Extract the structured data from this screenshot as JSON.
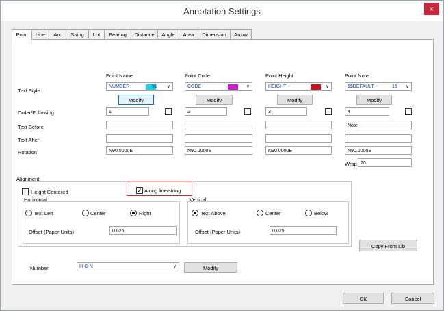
{
  "window": {
    "title": "Annotation Settings",
    "close_label": "×"
  },
  "tabs": [
    "Point",
    "Line",
    "Arc",
    "String",
    "Lot",
    "Bearing",
    "Distance",
    "Angle",
    "Area",
    "Dimension",
    "Arrow"
  ],
  "columns": {
    "point_name": {
      "header": "Point Name",
      "style": "NUMBER",
      "num": "51",
      "swatch": "#19d3e6",
      "modify": "Modify",
      "order": "1",
      "before": "",
      "after": "",
      "rotation": "N90.0000E"
    },
    "point_code": {
      "header": "Point Code",
      "style": "CODE",
      "num": "",
      "swatch": "#d51ad5",
      "modify": "Modify",
      "order": "2",
      "before": "",
      "after": "",
      "rotation": "N90.0000E"
    },
    "point_height": {
      "header": "Point Height",
      "style": "HEIGHT",
      "num": "",
      "swatch": "#d0101e",
      "modify": "Modify",
      "order": "3",
      "before": "",
      "after": "",
      "rotation": "N90.0000E"
    },
    "point_note": {
      "header": "Point Note",
      "style": "$$DEFAULT",
      "num": "15",
      "modify": "Modify",
      "order": "4",
      "before": "Note",
      "after": "",
      "rotation": "N90.0000E"
    }
  },
  "row_labels": {
    "text_style": "Text Style",
    "order": "Order/Following",
    "before": "Text Before",
    "after": "Text After",
    "rotation": "Rotation"
  },
  "wrap": {
    "label": "Wrap",
    "value": "20"
  },
  "alignment": {
    "group": "Alignment",
    "height_centered": "Height Centered",
    "along": "Along line/string",
    "horizontal": {
      "label": "Horizontal",
      "left": "Text Left",
      "center": "Center",
      "right": "Right",
      "offset_label": "Offset (Paper Units)",
      "offset": "0.025"
    },
    "vertical": {
      "label": "Vertical",
      "above": "Text Above",
      "center": "Center",
      "below": "Below",
      "offset_label": "Offset (Paper Units)",
      "offset": "0.025"
    }
  },
  "copy_from_lib": "Copy From Lib",
  "number": {
    "label": "Number",
    "value": "H-C-N",
    "modify": "Modify"
  },
  "footer": {
    "ok": "OK",
    "cancel": "Cancel"
  }
}
